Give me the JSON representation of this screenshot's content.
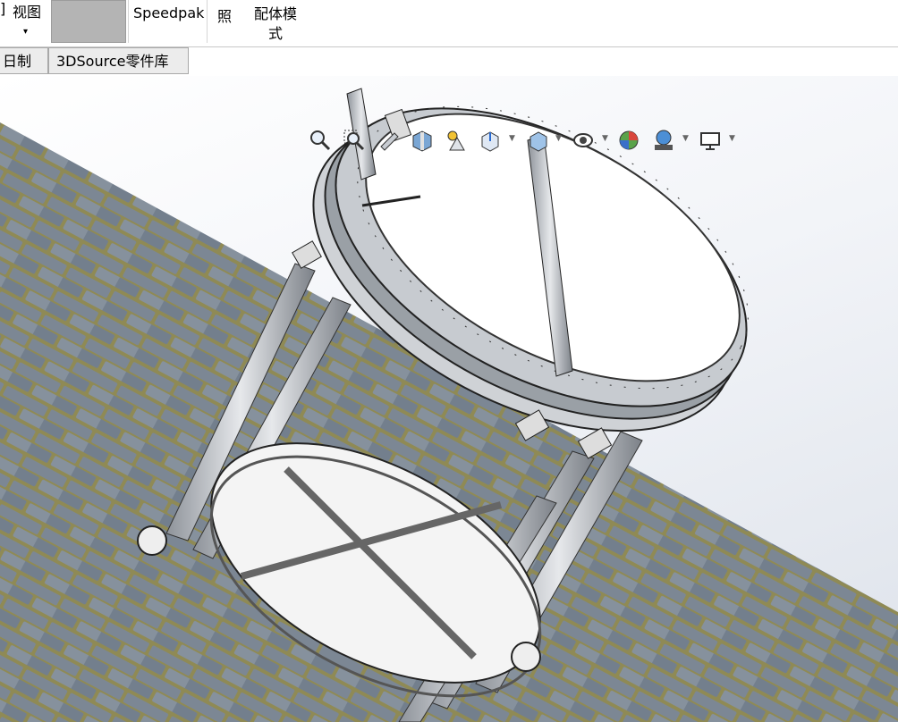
{
  "ribbon": {
    "view_left": "]",
    "view_label": "视图",
    "view_arrow": "▾",
    "speedpak": "Speedpak",
    "zhao": "照",
    "mate_mode": "配体模式"
  },
  "tabs": {
    "mfg": "日制造",
    "source3d": "3DSource零件库"
  },
  "hud": {
    "icons": [
      "zoom-to-fit-icon",
      "zoom-to-area-icon",
      "previous-view-icon",
      "section-view-icon",
      "dynamic-annotation-icon",
      "view-orientation-icon",
      "display-style-icon",
      "hide-show-icon",
      "edit-appearance-icon",
      "apply-scene-icon",
      "view-settings-icon"
    ]
  },
  "colors": {
    "ribbon_bg": "#ffffff",
    "tab_bg": "#ececec",
    "brick": "#7c8794",
    "mortar": "#8f8a55",
    "frame": "#c9cdd2"
  }
}
